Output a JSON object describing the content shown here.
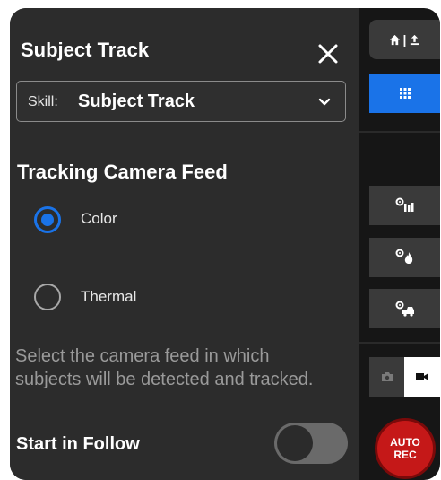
{
  "panel": {
    "title": "Subject Track",
    "close_icon": "close-icon",
    "skill_select": {
      "prefix": "Skill:",
      "value": "Subject Track",
      "icon": "chevron-down-icon"
    },
    "tracking_feed": {
      "title": "Tracking Camera Feed",
      "options": [
        {
          "label": "Color",
          "selected": true
        },
        {
          "label": "Thermal",
          "selected": false
        }
      ],
      "helper_text": "Select the camera feed in which subjects will be detected and tracked."
    },
    "follow": {
      "label": "Start in Follow",
      "enabled": false
    }
  },
  "rail": {
    "home_upload_separator": "|",
    "icons": [
      "home-icon",
      "upload-icon",
      "grid-icon",
      "gear-track-icon",
      "gear-fire-icon",
      "gear-vehicle-icon",
      "camera-icon",
      "video-icon"
    ],
    "record": {
      "line1": "AUTO",
      "line2": "REC"
    }
  },
  "colors": {
    "accent": "#1a73e8",
    "record": "#c51818",
    "panel_bg": "#2c2c2c",
    "frame_bg": "#161616"
  }
}
